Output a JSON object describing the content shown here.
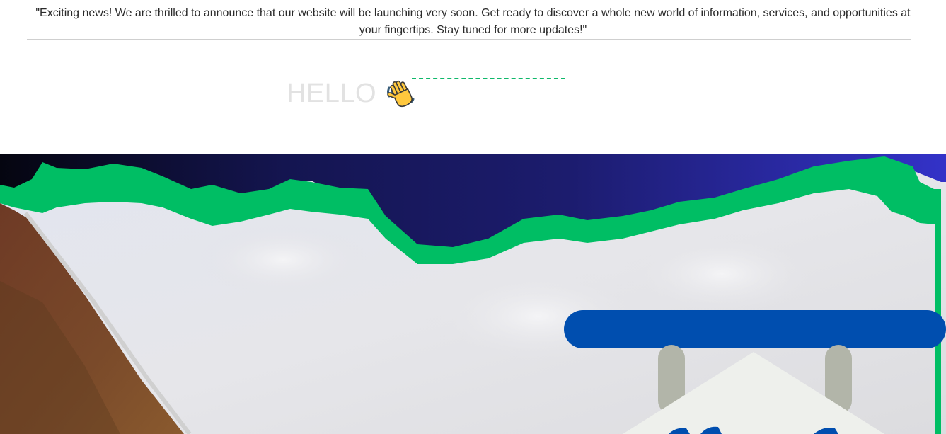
{
  "announcement": {
    "text": "\"Exciting news! We are thrilled to announce that our website will be launching very soon. Get ready to discover a whole new world of information, services, and opportunities at your fingertips. Stay tuned for more updates!\""
  },
  "greeting": {
    "hello": "HELLO",
    "icon": "waving-hand-icon"
  },
  "colors": {
    "accent_green": "#00be64",
    "sign_blue": "#004eaf",
    "hero_gradient_start": "#050510",
    "hero_gradient_end": "#3332c8"
  }
}
